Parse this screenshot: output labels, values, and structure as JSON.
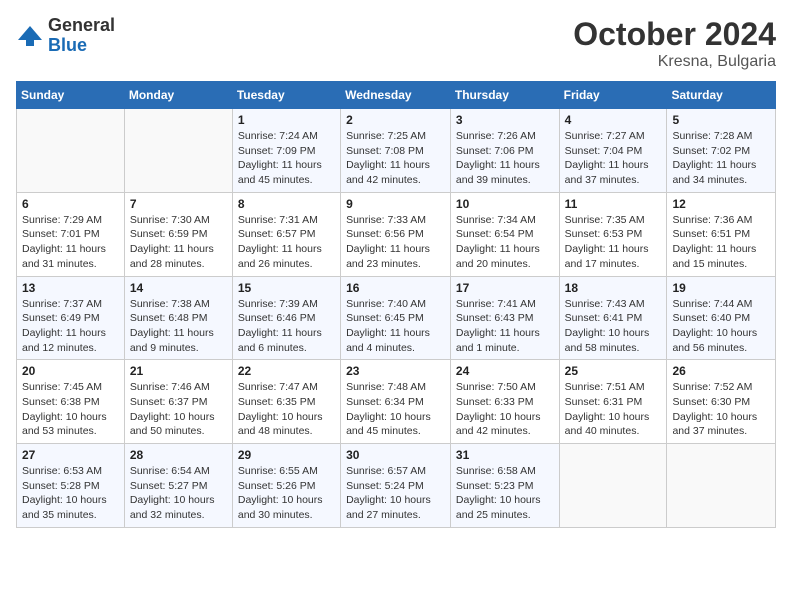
{
  "header": {
    "logo_general": "General",
    "logo_blue": "Blue",
    "month_year": "October 2024",
    "location": "Kresna, Bulgaria"
  },
  "days_of_week": [
    "Sunday",
    "Monday",
    "Tuesday",
    "Wednesday",
    "Thursday",
    "Friday",
    "Saturday"
  ],
  "weeks": [
    [
      {
        "day": "",
        "sunrise": "",
        "sunset": "",
        "daylight": ""
      },
      {
        "day": "",
        "sunrise": "",
        "sunset": "",
        "daylight": ""
      },
      {
        "day": "1",
        "sunrise": "Sunrise: 7:24 AM",
        "sunset": "Sunset: 7:09 PM",
        "daylight": "Daylight: 11 hours and 45 minutes."
      },
      {
        "day": "2",
        "sunrise": "Sunrise: 7:25 AM",
        "sunset": "Sunset: 7:08 PM",
        "daylight": "Daylight: 11 hours and 42 minutes."
      },
      {
        "day": "3",
        "sunrise": "Sunrise: 7:26 AM",
        "sunset": "Sunset: 7:06 PM",
        "daylight": "Daylight: 11 hours and 39 minutes."
      },
      {
        "day": "4",
        "sunrise": "Sunrise: 7:27 AM",
        "sunset": "Sunset: 7:04 PM",
        "daylight": "Daylight: 11 hours and 37 minutes."
      },
      {
        "day": "5",
        "sunrise": "Sunrise: 7:28 AM",
        "sunset": "Sunset: 7:02 PM",
        "daylight": "Daylight: 11 hours and 34 minutes."
      }
    ],
    [
      {
        "day": "6",
        "sunrise": "Sunrise: 7:29 AM",
        "sunset": "Sunset: 7:01 PM",
        "daylight": "Daylight: 11 hours and 31 minutes."
      },
      {
        "day": "7",
        "sunrise": "Sunrise: 7:30 AM",
        "sunset": "Sunset: 6:59 PM",
        "daylight": "Daylight: 11 hours and 28 minutes."
      },
      {
        "day": "8",
        "sunrise": "Sunrise: 7:31 AM",
        "sunset": "Sunset: 6:57 PM",
        "daylight": "Daylight: 11 hours and 26 minutes."
      },
      {
        "day": "9",
        "sunrise": "Sunrise: 7:33 AM",
        "sunset": "Sunset: 6:56 PM",
        "daylight": "Daylight: 11 hours and 23 minutes."
      },
      {
        "day": "10",
        "sunrise": "Sunrise: 7:34 AM",
        "sunset": "Sunset: 6:54 PM",
        "daylight": "Daylight: 11 hours and 20 minutes."
      },
      {
        "day": "11",
        "sunrise": "Sunrise: 7:35 AM",
        "sunset": "Sunset: 6:53 PM",
        "daylight": "Daylight: 11 hours and 17 minutes."
      },
      {
        "day": "12",
        "sunrise": "Sunrise: 7:36 AM",
        "sunset": "Sunset: 6:51 PM",
        "daylight": "Daylight: 11 hours and 15 minutes."
      }
    ],
    [
      {
        "day": "13",
        "sunrise": "Sunrise: 7:37 AM",
        "sunset": "Sunset: 6:49 PM",
        "daylight": "Daylight: 11 hours and 12 minutes."
      },
      {
        "day": "14",
        "sunrise": "Sunrise: 7:38 AM",
        "sunset": "Sunset: 6:48 PM",
        "daylight": "Daylight: 11 hours and 9 minutes."
      },
      {
        "day": "15",
        "sunrise": "Sunrise: 7:39 AM",
        "sunset": "Sunset: 6:46 PM",
        "daylight": "Daylight: 11 hours and 6 minutes."
      },
      {
        "day": "16",
        "sunrise": "Sunrise: 7:40 AM",
        "sunset": "Sunset: 6:45 PM",
        "daylight": "Daylight: 11 hours and 4 minutes."
      },
      {
        "day": "17",
        "sunrise": "Sunrise: 7:41 AM",
        "sunset": "Sunset: 6:43 PM",
        "daylight": "Daylight: 11 hours and 1 minute."
      },
      {
        "day": "18",
        "sunrise": "Sunrise: 7:43 AM",
        "sunset": "Sunset: 6:41 PM",
        "daylight": "Daylight: 10 hours and 58 minutes."
      },
      {
        "day": "19",
        "sunrise": "Sunrise: 7:44 AM",
        "sunset": "Sunset: 6:40 PM",
        "daylight": "Daylight: 10 hours and 56 minutes."
      }
    ],
    [
      {
        "day": "20",
        "sunrise": "Sunrise: 7:45 AM",
        "sunset": "Sunset: 6:38 PM",
        "daylight": "Daylight: 10 hours and 53 minutes."
      },
      {
        "day": "21",
        "sunrise": "Sunrise: 7:46 AM",
        "sunset": "Sunset: 6:37 PM",
        "daylight": "Daylight: 10 hours and 50 minutes."
      },
      {
        "day": "22",
        "sunrise": "Sunrise: 7:47 AM",
        "sunset": "Sunset: 6:35 PM",
        "daylight": "Daylight: 10 hours and 48 minutes."
      },
      {
        "day": "23",
        "sunrise": "Sunrise: 7:48 AM",
        "sunset": "Sunset: 6:34 PM",
        "daylight": "Daylight: 10 hours and 45 minutes."
      },
      {
        "day": "24",
        "sunrise": "Sunrise: 7:50 AM",
        "sunset": "Sunset: 6:33 PM",
        "daylight": "Daylight: 10 hours and 42 minutes."
      },
      {
        "day": "25",
        "sunrise": "Sunrise: 7:51 AM",
        "sunset": "Sunset: 6:31 PM",
        "daylight": "Daylight: 10 hours and 40 minutes."
      },
      {
        "day": "26",
        "sunrise": "Sunrise: 7:52 AM",
        "sunset": "Sunset: 6:30 PM",
        "daylight": "Daylight: 10 hours and 37 minutes."
      }
    ],
    [
      {
        "day": "27",
        "sunrise": "Sunrise: 6:53 AM",
        "sunset": "Sunset: 5:28 PM",
        "daylight": "Daylight: 10 hours and 35 minutes."
      },
      {
        "day": "28",
        "sunrise": "Sunrise: 6:54 AM",
        "sunset": "Sunset: 5:27 PM",
        "daylight": "Daylight: 10 hours and 32 minutes."
      },
      {
        "day": "29",
        "sunrise": "Sunrise: 6:55 AM",
        "sunset": "Sunset: 5:26 PM",
        "daylight": "Daylight: 10 hours and 30 minutes."
      },
      {
        "day": "30",
        "sunrise": "Sunrise: 6:57 AM",
        "sunset": "Sunset: 5:24 PM",
        "daylight": "Daylight: 10 hours and 27 minutes."
      },
      {
        "day": "31",
        "sunrise": "Sunrise: 6:58 AM",
        "sunset": "Sunset: 5:23 PM",
        "daylight": "Daylight: 10 hours and 25 minutes."
      },
      {
        "day": "",
        "sunrise": "",
        "sunset": "",
        "daylight": ""
      },
      {
        "day": "",
        "sunrise": "",
        "sunset": "",
        "daylight": ""
      }
    ]
  ]
}
